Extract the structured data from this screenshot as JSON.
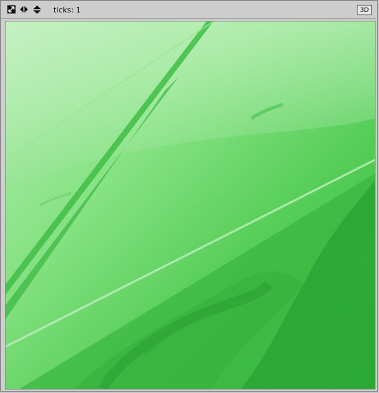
{
  "toolbar": {
    "ticks_label": "ticks: 1",
    "view_mode_label": "3D",
    "icons": [
      "zoom-icon",
      "pan-icon",
      "move-icon"
    ]
  },
  "view": {
    "description_colors": {
      "light": "#b9efb6",
      "mid": "#6fdd68",
      "dark": "#2fae35",
      "deep": "#1f9b2a"
    }
  }
}
